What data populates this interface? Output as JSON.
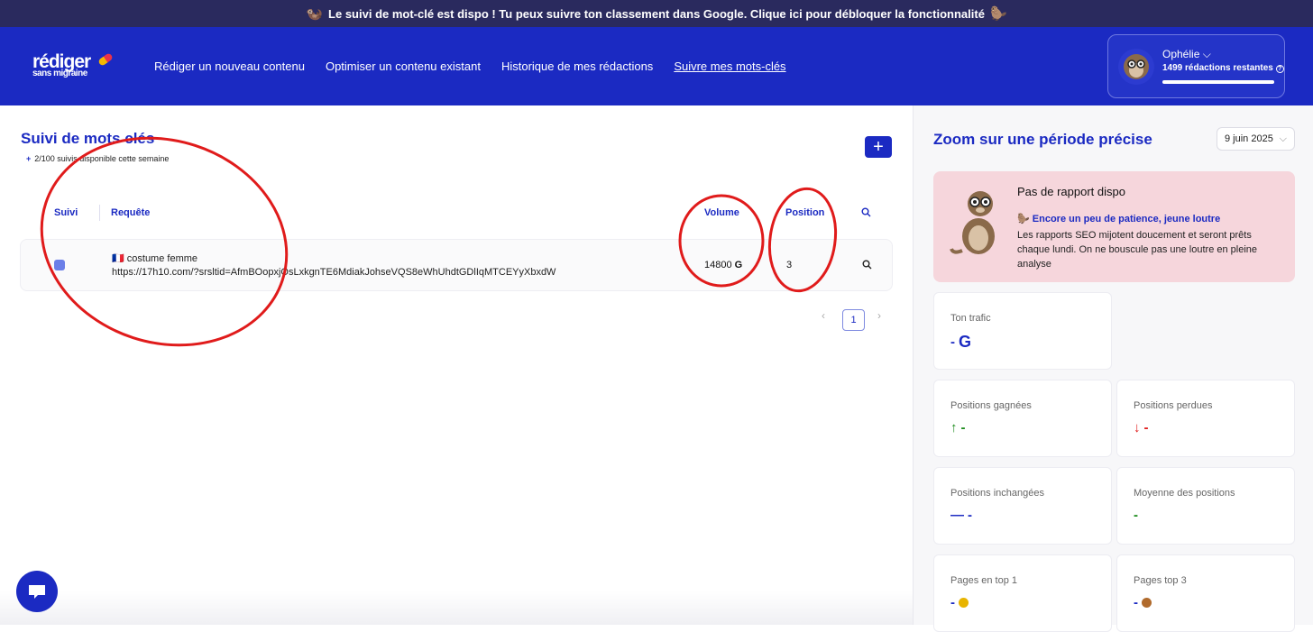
{
  "announcement": {
    "text": "Le suivi de mot-clé est dispo ! Tu peux suivre ton classement dans Google. Clique ici pour débloquer la fonctionnalité"
  },
  "brand": {
    "line1": "rédiger",
    "line2": "sans migraine",
    "accent": "#1b2ac2"
  },
  "nav": {
    "links": [
      "Rédiger un nouveau contenu",
      "Optimiser un contenu existant",
      "Historique de mes rédactions",
      "Suivre mes mots-clés"
    ],
    "active": "Suivre mes mots-clés"
  },
  "user": {
    "name": "Ophélie",
    "remaining": "1499 rédactions restantes"
  },
  "tracking": {
    "title": "Suivi de mots clés",
    "quota_prefix": "+",
    "quota": "2/100 suivis disponible cette semaine",
    "add_label": "+",
    "headers": {
      "suivi": "Suivi",
      "requete": "Requête",
      "volume": "Volume",
      "position": "Position"
    },
    "rows": [
      {
        "flag": "🇫🇷",
        "keyword": "costume femme",
        "url": "https://17h10.com/?srsltid=AfmBOopxjOsLxkgnTE6MdiakJohseVQS8eWhUhdtGDlIqMTCEYyXbxdW",
        "volume": "14800",
        "position": "3"
      }
    ],
    "pagination": {
      "current": "1",
      "prev": "‹",
      "next": "›"
    }
  },
  "zoom": {
    "title": "Zoom sur une période précise",
    "date": "9 juin 2025",
    "alert": {
      "title": "Pas de rapport dispo",
      "subtitle": "Encore un peu de patience, jeune loutre",
      "body": "Les rapports SEO mijotent doucement et seront prêts chaque lundi. On ne bouscule pas une loutre en pleine analyse"
    },
    "cards": {
      "trafic": {
        "label": "Ton trafic",
        "value": "-"
      },
      "gagnees": {
        "label": "Positions gagnées",
        "value": "-"
      },
      "perdues": {
        "label": "Positions perdues",
        "value": "-"
      },
      "inchangees": {
        "label": "Positions inchangées",
        "value": "-"
      },
      "moyenne": {
        "label": "Moyenne des positions",
        "value": "-"
      },
      "top1": {
        "label": "Pages en top 1",
        "value": "-"
      },
      "top3": {
        "label": "Pages top 3",
        "value": "-"
      }
    }
  },
  "colors": {
    "up": "#1a8a1a",
    "down": "#e01b1b",
    "neutral_line": "#1b2ac2",
    "alert_bg": "#f6d6dc"
  }
}
